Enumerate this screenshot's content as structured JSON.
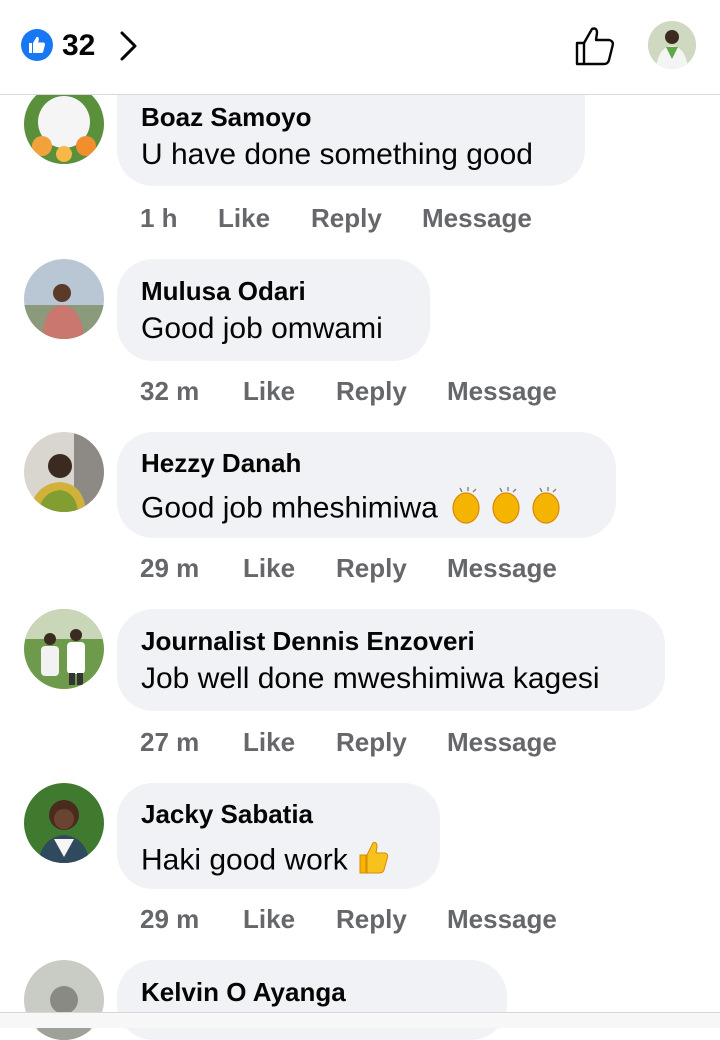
{
  "header": {
    "like_count": "32",
    "like_icon": "like-reaction-icon",
    "forward_icon": "chevron-right-icon",
    "thumb_icon": "thumbs-up-outline-icon",
    "accent": "#1877f2"
  },
  "actions": {
    "like": "Like",
    "reply": "Reply",
    "message": "Message"
  },
  "comments": [
    {
      "author": "Boaz Samoyo",
      "text": "U have done something good",
      "time": "1 h"
    },
    {
      "author": "Mulusa Odari",
      "text": "Good job omwami",
      "time": "32 m"
    },
    {
      "author": "Hezzy Danah",
      "text": "Good job mheshimiwa",
      "emoji": "clapping-hands ×3",
      "time": "29 m"
    },
    {
      "author": "Journalist Dennis Enzoveri",
      "text": "Job well done mweshimiwa kagesi",
      "time": "27 m"
    },
    {
      "author": "Jacky Sabatia",
      "text": "Haki good work",
      "emoji": "thumbs-up",
      "time": "29 m"
    },
    {
      "author": "Kelvin O Ayanga",
      "text": ""
    }
  ],
  "colors": {
    "bubble": "#f0f2f5",
    "meta": "#65676b",
    "text": "#050505"
  }
}
